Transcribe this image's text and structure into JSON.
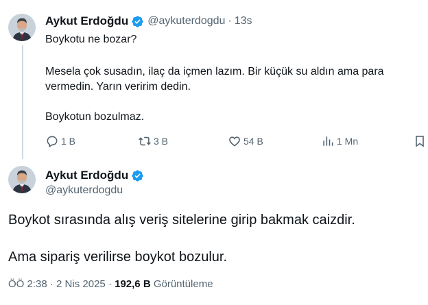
{
  "colors": {
    "text_primary": "#0f1419",
    "text_secondary": "#536471",
    "verified_blue": "#1d9bf0",
    "thread_line": "#cfd9de"
  },
  "reply_tweet": {
    "author_name": "Aykut Erdoğdu",
    "handle": "@aykuterdogdu",
    "separator": "·",
    "time": "13s",
    "line1": "Boykotu ne bozar?",
    "line2": "Mesela çok susadın, ilaç da içmen lazım. Bir  küçük su aldın ama para",
    "line3": "vermedin. Yarın veririm dedin.",
    "line4": "Boykotun bozulmaz.",
    "actions": {
      "reply": {
        "icon": "reply-icon",
        "count": "1 B"
      },
      "retweet": {
        "icon": "retweet-icon",
        "count": "3 B"
      },
      "like": {
        "icon": "heart-icon",
        "count": "54 B"
      },
      "views": {
        "icon": "views-icon",
        "count": "1 Mn"
      },
      "bookmark": {
        "icon": "bookmark-icon"
      }
    }
  },
  "main_tweet": {
    "author_name": "Aykut Erdoğdu",
    "handle": "@aykuterdogdu",
    "line1": "Boykot sırasında alış veriş sitelerine girip bakmak caizdir.",
    "line2": "Ama sipariş verilirse boykot bozulur.",
    "timestamp": "ÖÖ 2:38",
    "date": "2 Nis 2025",
    "separator": "·",
    "views_count": "192,6 B",
    "views_label": "Görüntüleme"
  }
}
